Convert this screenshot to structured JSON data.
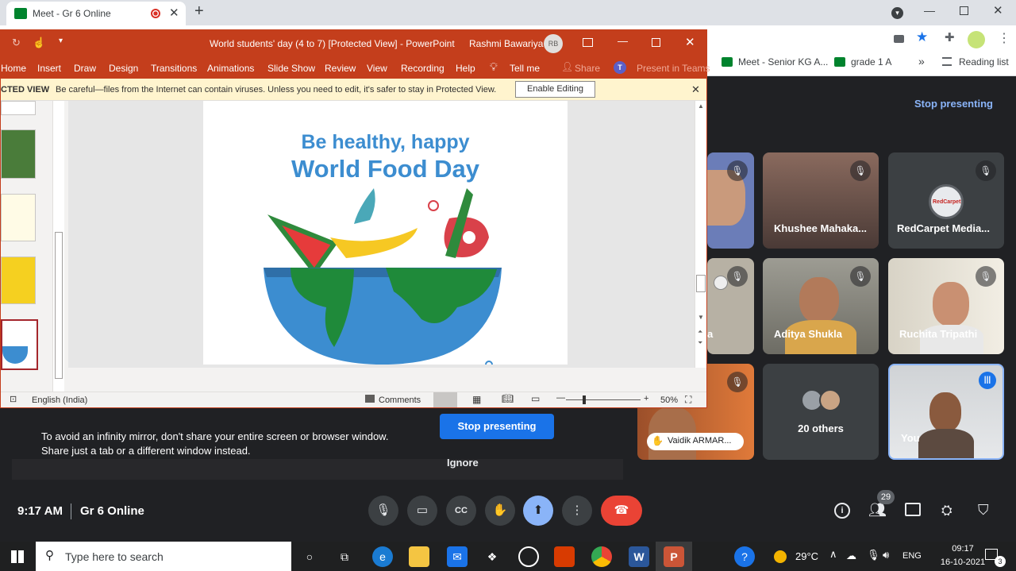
{
  "chrome": {
    "tab_title": "Meet - Gr 6 Online",
    "bookmarks": [
      "Meet - Senior KG A...",
      "grade 1 A"
    ],
    "more_label": "»",
    "reading_list": "Reading list"
  },
  "ppt": {
    "window_title": "World students' day (4 to 7) [Protected View]  -  PowerPoint",
    "user_name": "Rashmi Bawariya",
    "user_initials": "RB",
    "menu": [
      "Home",
      "Insert",
      "Draw",
      "Design",
      "Transitions",
      "Animations",
      "Slide Show",
      "Review",
      "View",
      "Recording",
      "Help"
    ],
    "tell_me": "Tell me",
    "share": "Share",
    "present_teams": "Present in Teams",
    "protected_label": "CTED VIEW",
    "protected_message": "Be careful—files from the Internet can contain viruses. Unless you need to edit, it's safer to stay in Protected View.",
    "enable_editing": "Enable Editing",
    "slide_title_line1": "Be healthy, happy",
    "slide_title_line2": "World Food Day",
    "status_language": "English (India)",
    "status_comments": "Comments",
    "zoom": "50%"
  },
  "meet": {
    "stop_presenting_top": "Stop presenting",
    "participants": [
      {
        "name": "Khushee Mahaka..."
      },
      {
        "name": "RedCarpet Media..."
      },
      {
        "name": "Aditya Shukla"
      },
      {
        "name": "Ruchita Tripathi"
      },
      {
        "name": "20 others"
      },
      {
        "name": "You"
      },
      {
        "name": "Vaidik ARMAR..."
      }
    ],
    "partial_name": "a",
    "mirror_warning": "To avoid an infinity mirror, don't share your entire screen or browser window. Share just a tab or a different window instead.",
    "stop_presenting_button": "Stop presenting",
    "ignore_button": "Ignore",
    "time": "9:17 AM",
    "meeting_name": "Gr 6 Online",
    "people_count": "29",
    "redcarpet_logo_text": "RedCarpet"
  },
  "taskbar": {
    "search_placeholder": "Type here to search",
    "weather": "29°C",
    "language": "ENG",
    "clock_time": "09:17",
    "clock_date": "16-10-2021",
    "notification_count": "3"
  },
  "colors": {
    "ppt_red": "#c43e1c",
    "meet_bg": "#202124",
    "meet_blue": "#8ab4f8",
    "hangup_red": "#ea4335",
    "slide_blue": "#3c8dd0"
  }
}
